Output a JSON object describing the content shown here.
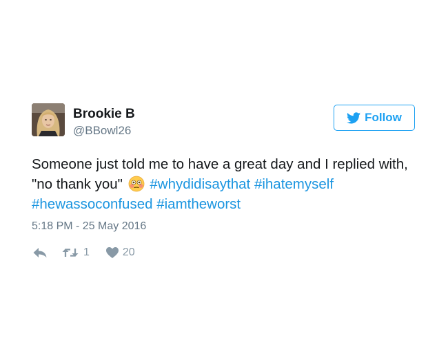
{
  "tweet": {
    "display_name": "Brookie B",
    "handle": "@BBowl26",
    "follow_label": "Follow",
    "text_before_emoji": "Someone just told me to have a great day and I replied with, \"no thank you\" ",
    "hashtags": [
      "#whydidisaythat",
      "#ihatemyself",
      "#hewassoconfused",
      "#iamtheworst"
    ],
    "emoji": "flushed-face-emoji",
    "timestamp": "5:18 PM - 25 May 2016",
    "retweet_count": "1",
    "like_count": "20"
  },
  "colors": {
    "brand_blue": "#1da1f2",
    "hashtag_blue": "#1b95e0",
    "text": "#14171a",
    "secondary": "#657786",
    "icon_gray": "#8899a6"
  },
  "icons": {
    "follow": "twitter-bird-icon",
    "reply": "reply-arrow-icon",
    "retweet": "retweet-icon",
    "like": "heart-icon"
  }
}
